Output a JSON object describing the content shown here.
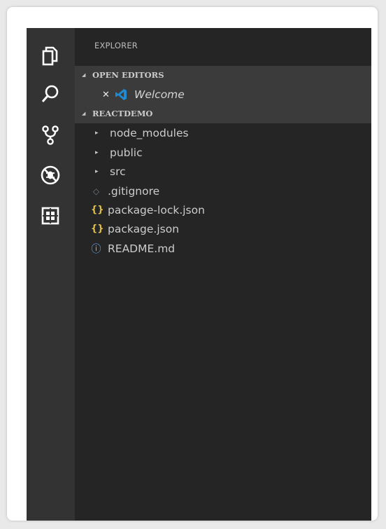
{
  "activity_bar": {
    "icons": [
      "files-icon",
      "search-icon",
      "source-control-icon",
      "debug-icon",
      "extensions-icon"
    ]
  },
  "explorer": {
    "title": "EXPLORER",
    "open_editors": {
      "header": "OPEN EDITORS",
      "items": [
        {
          "label": "Welcome",
          "icon": "vscode-icon"
        }
      ]
    },
    "project": {
      "header": "REACTDEMO",
      "items": [
        {
          "label": "node_modules",
          "kind": "folder"
        },
        {
          "label": "public",
          "kind": "folder"
        },
        {
          "label": "src",
          "kind": "folder"
        },
        {
          "label": ".gitignore",
          "kind": "file",
          "icon": "git-diamond-icon"
        },
        {
          "label": "package-lock.json",
          "kind": "file",
          "icon": "json-icon"
        },
        {
          "label": "package.json",
          "kind": "file",
          "icon": "json-icon"
        },
        {
          "label": "README.md",
          "kind": "file",
          "icon": "info-icon"
        }
      ]
    }
  },
  "colors": {
    "activity_bar": "#333333",
    "side_bar": "#252526",
    "section_highlight": "#3b3b3c",
    "json_icon": "#e2c14a",
    "info_icon": "#75beff",
    "vscode_blue": "#1f8ad2"
  }
}
